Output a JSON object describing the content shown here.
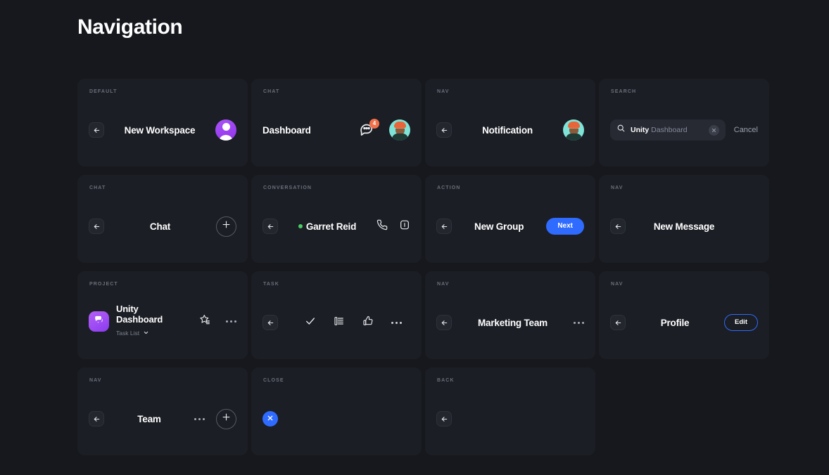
{
  "page": {
    "title": "Navigation",
    "background": "#16181d",
    "card_background": "#1b1e24",
    "accent_blue": "#2f6bff",
    "accent_purple": "#a855f7",
    "badge_orange": "#f2714b",
    "online_green": "#4ccb63"
  },
  "cards": {
    "default_workspace": {
      "tag": "DEFAULT",
      "title": "New Workspace",
      "back_icon": "arrow-left-icon",
      "avatar_icon": "user-avatar-icon"
    },
    "chat_dashboard": {
      "tag": "CHAT",
      "title": "Dashboard",
      "message_icon": "chat-bubble-icon",
      "badge_count": "4",
      "avatar_icon": "user-photo-avatar"
    },
    "nav_notification": {
      "tag": "NAV",
      "title": "Notification",
      "back_icon": "arrow-left-icon",
      "avatar_icon": "user-photo-avatar"
    },
    "search": {
      "tag": "SEARCH",
      "query": "Unity",
      "placeholder": "Dashboard",
      "search_icon": "search-icon",
      "clear_icon": "close-icon",
      "cancel_label": "Cancel"
    },
    "chat": {
      "tag": "CHAT",
      "title": "Chat",
      "back_icon": "arrow-left-icon",
      "add_icon": "plus-icon"
    },
    "conversation": {
      "tag": "CONVERSATION",
      "title": "Garret Reid",
      "status": "online",
      "back_icon": "arrow-left-icon",
      "call_icon": "phone-icon",
      "video_icon": "video-icon"
    },
    "action_new_group": {
      "tag": "ACTION",
      "title": "New Group",
      "back_icon": "arrow-left-icon",
      "next_label": "Next"
    },
    "nav_new_message": {
      "tag": "NAV",
      "title": "New Message",
      "back_icon": "arrow-left-icon"
    },
    "project": {
      "tag": "PROJECT",
      "title": "Unity Dashboard",
      "subtitle": "Task List",
      "project_icon": "layers-chat-icon",
      "chevron_icon": "chevron-down-icon",
      "star_icon": "star-list-icon",
      "more_icon": "more-horizontal-icon"
    },
    "task": {
      "tag": "TASK",
      "back_icon": "arrow-left-icon",
      "check_icon": "check-icon",
      "list_icon": "kanban-list-icon",
      "like_icon": "thumbs-up-icon",
      "more_icon": "more-horizontal-icon"
    },
    "nav_marketing_team": {
      "tag": "NAV",
      "title": "Marketing Team",
      "back_icon": "arrow-left-icon",
      "more_icon": "more-horizontal-icon"
    },
    "nav_profile": {
      "tag": "NAV",
      "title": "Profile",
      "back_icon": "arrow-left-icon",
      "edit_label": "Edit"
    },
    "nav_team": {
      "tag": "NAV",
      "title": "Team",
      "back_icon": "arrow-left-icon",
      "more_icon": "more-horizontal-icon",
      "add_icon": "plus-icon"
    },
    "close": {
      "tag": "CLOSE",
      "close_icon": "close-icon"
    },
    "back": {
      "tag": "BACK",
      "back_icon": "arrow-left-icon"
    }
  }
}
